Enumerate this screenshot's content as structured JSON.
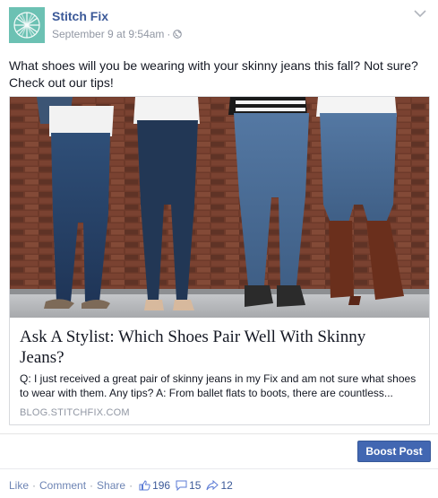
{
  "post": {
    "page_name": "Stitch Fix",
    "timestamp": "September 9 at 9:54am",
    "meta_separator": "·",
    "text": "What shoes will you be wearing with your skinny jeans this fall? Not sure? Check out our tips!"
  },
  "attachment": {
    "title": "Ask A Stylist: Which Shoes Pair Well With Skinny Jeans?",
    "description": "Q: I just received a great pair of skinny jeans in my Fix and am not sure what shoes to wear with them. Any tips? A: From ballet flats to boots, there are countless...",
    "domain": "BLOG.STITCHFIX.COM"
  },
  "boost_label": "Boost Post",
  "actions": {
    "like": "Like",
    "comment": "Comment",
    "share": "Share",
    "separator": "·",
    "likes_count": "196",
    "comments_count": "15",
    "shares_count": "12"
  },
  "icons": {
    "globe": "globe-icon",
    "chevron": "chevron-down-icon",
    "like": "thumbs-up-icon",
    "comment": "comment-bubble-icon",
    "share": "share-arrow-icon"
  },
  "colors": {
    "brand": "#3b5998",
    "boost": "#4267b2",
    "avatar": "#6cc1b3"
  }
}
